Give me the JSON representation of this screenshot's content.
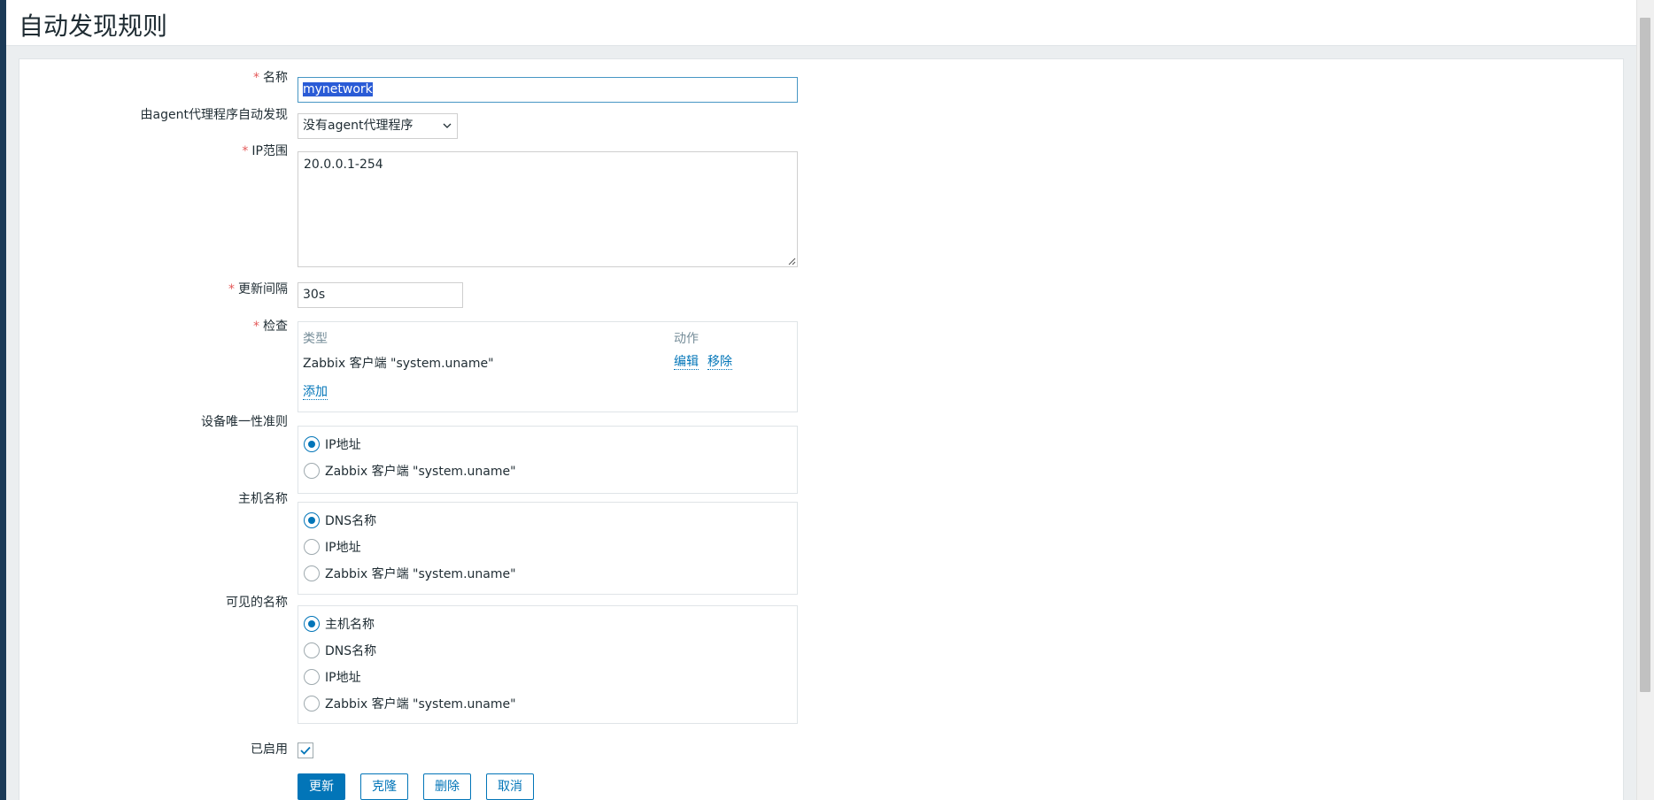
{
  "page": {
    "title": "自动发现规则"
  },
  "form": {
    "name": {
      "label": "名称",
      "value": "mynetwork"
    },
    "proxy": {
      "label": "由agent代理程序自动发现",
      "value": "没有agent代理程序"
    },
    "ip_range": {
      "label": "IP范围",
      "value": "20.0.0.1-254"
    },
    "update_interval": {
      "label": "更新间隔",
      "value": "30s"
    },
    "checks": {
      "label": "检查",
      "col_type": "类型",
      "col_action": "动作",
      "rows": [
        {
          "type": "Zabbix 客户端 \"system.uname\"",
          "edit": "编辑",
          "remove": "移除"
        }
      ],
      "add": "添加"
    },
    "uniqueness": {
      "label": "设备唯一性准则",
      "options": [
        "IP地址",
        "Zabbix 客户端 \"system.uname\""
      ],
      "selected": 0
    },
    "host_name": {
      "label": "主机名称",
      "options": [
        "DNS名称",
        "IP地址",
        "Zabbix 客户端 \"system.uname\""
      ],
      "selected": 0
    },
    "visible_name": {
      "label": "可见的名称",
      "options": [
        "主机名称",
        "DNS名称",
        "IP地址",
        "Zabbix 客户端 \"system.uname\""
      ],
      "selected": 0
    },
    "enabled": {
      "label": "已启用",
      "checked": true
    }
  },
  "buttons": {
    "update": "更新",
    "clone": "克隆",
    "delete": "删除",
    "cancel": "取消"
  },
  "colors": {
    "accent": "#0275b8",
    "required": "#e45959",
    "header_bg": "#ebeef0"
  }
}
